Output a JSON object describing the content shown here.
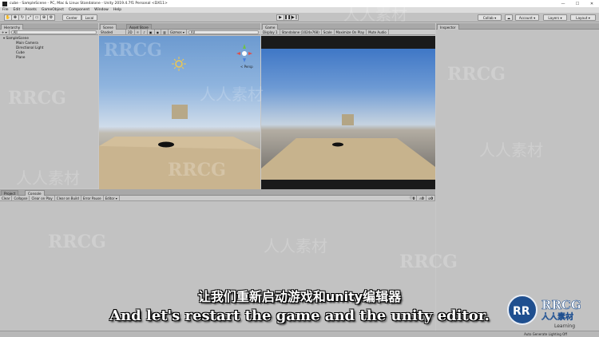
{
  "window": {
    "title": "cube - SampleScene - PC, Mac & Linux Standalone - Unity 2019.4.7f1 Personal <DX11>",
    "controls": [
      "—",
      "☐",
      "✕"
    ]
  },
  "menu": [
    "File",
    "Edit",
    "Assets",
    "GameObject",
    "Component",
    "Window",
    "Help"
  ],
  "toolbar": {
    "pivot": "Center",
    "space": "Local",
    "collab": "Collab ▾",
    "account": "Account ▾",
    "layers": "Layers ▾",
    "layout": "Layout ▾"
  },
  "hierarchy": {
    "tab": "Hierarchy",
    "create": "+ ▾",
    "search_placeholder": "All",
    "scene": "SampleScene",
    "items": [
      "Main Camera",
      "Directional Light",
      "Cube",
      "Plane"
    ]
  },
  "scene": {
    "tabs": [
      "Scene",
      "Asset Store"
    ],
    "shading": "Shaded",
    "mode": "2D",
    "gizmos": "Gizmos ▾",
    "search_placeholder": "All",
    "persp": "< Persp"
  },
  "game": {
    "tab": "Game",
    "display": "Display 1",
    "resolution": "Standalone (1024x768)",
    "scale": "Scale",
    "maximize": "Maximize On Play",
    "mute": "Mute Audio"
  },
  "inspector": {
    "tab": "Inspector"
  },
  "console": {
    "tabs": [
      "Project",
      "Console"
    ],
    "buttons": [
      "Clear",
      "Collapse",
      "Clear on Play",
      "Clear on Build",
      "Error Pause",
      "Editor ▾"
    ],
    "counts": [
      "0",
      "0",
      "0"
    ]
  },
  "status": {
    "text": "Auto Generate Lighting Off"
  },
  "subtitles": {
    "zh": "让我们重新启动游戏和unity编辑器",
    "en": "And let's restart the game and the unity editor."
  },
  "watermark": {
    "text_a": "RRCG",
    "text_b": "人人素材",
    "logo_brand": "RRCG",
    "logo_sub": "人人素材",
    "logo_learning": "Learning"
  },
  "colors": {
    "editor_bg": "#c2c2c2",
    "sky_top": "#6c9ad0",
    "ground": "#c9b48f",
    "subtitle": "#ffffff"
  }
}
